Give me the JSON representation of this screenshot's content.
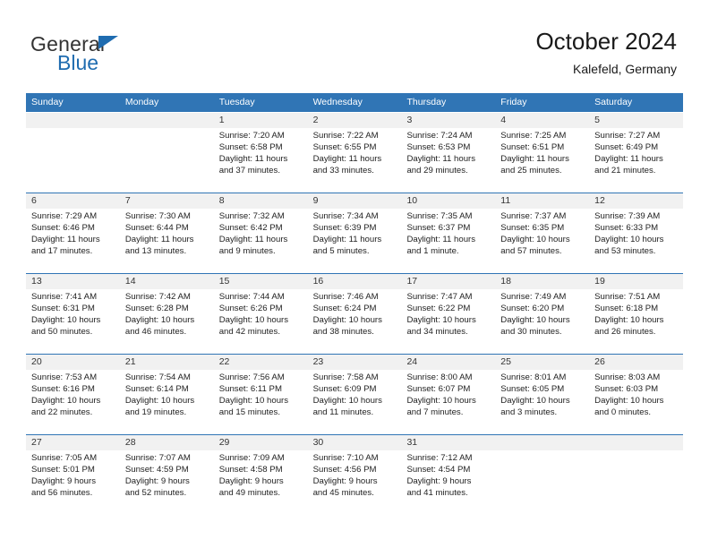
{
  "logo": {
    "text_primary": "General",
    "text_secondary": "Blue",
    "triangle_icon": "triangle-icon",
    "primary_color": "#333333",
    "accent_color": "#1f6cb0"
  },
  "header": {
    "title": "October 2024",
    "subtitle": "Kalefeld, Germany"
  },
  "theme": {
    "header_blue": "#3075b5",
    "date_band_gray": "#f1f1f1",
    "text_color": "#222222"
  },
  "weekdays": [
    "Sunday",
    "Monday",
    "Tuesday",
    "Wednesday",
    "Thursday",
    "Friday",
    "Saturday"
  ],
  "weeks": [
    {
      "days": [
        {
          "num": "",
          "sunrise": "",
          "sunset": "",
          "daylight1": "",
          "daylight2": ""
        },
        {
          "num": "",
          "sunrise": "",
          "sunset": "",
          "daylight1": "",
          "daylight2": ""
        },
        {
          "num": "1",
          "sunrise": "Sunrise: 7:20 AM",
          "sunset": "Sunset: 6:58 PM",
          "daylight1": "Daylight: 11 hours",
          "daylight2": "and 37 minutes."
        },
        {
          "num": "2",
          "sunrise": "Sunrise: 7:22 AM",
          "sunset": "Sunset: 6:55 PM",
          "daylight1": "Daylight: 11 hours",
          "daylight2": "and 33 minutes."
        },
        {
          "num": "3",
          "sunrise": "Sunrise: 7:24 AM",
          "sunset": "Sunset: 6:53 PM",
          "daylight1": "Daylight: 11 hours",
          "daylight2": "and 29 minutes."
        },
        {
          "num": "4",
          "sunrise": "Sunrise: 7:25 AM",
          "sunset": "Sunset: 6:51 PM",
          "daylight1": "Daylight: 11 hours",
          "daylight2": "and 25 minutes."
        },
        {
          "num": "5",
          "sunrise": "Sunrise: 7:27 AM",
          "sunset": "Sunset: 6:49 PM",
          "daylight1": "Daylight: 11 hours",
          "daylight2": "and 21 minutes."
        }
      ]
    },
    {
      "days": [
        {
          "num": "6",
          "sunrise": "Sunrise: 7:29 AM",
          "sunset": "Sunset: 6:46 PM",
          "daylight1": "Daylight: 11 hours",
          "daylight2": "and 17 minutes."
        },
        {
          "num": "7",
          "sunrise": "Sunrise: 7:30 AM",
          "sunset": "Sunset: 6:44 PM",
          "daylight1": "Daylight: 11 hours",
          "daylight2": "and 13 minutes."
        },
        {
          "num": "8",
          "sunrise": "Sunrise: 7:32 AM",
          "sunset": "Sunset: 6:42 PM",
          "daylight1": "Daylight: 11 hours",
          "daylight2": "and 9 minutes."
        },
        {
          "num": "9",
          "sunrise": "Sunrise: 7:34 AM",
          "sunset": "Sunset: 6:39 PM",
          "daylight1": "Daylight: 11 hours",
          "daylight2": "and 5 minutes."
        },
        {
          "num": "10",
          "sunrise": "Sunrise: 7:35 AM",
          "sunset": "Sunset: 6:37 PM",
          "daylight1": "Daylight: 11 hours",
          "daylight2": "and 1 minute."
        },
        {
          "num": "11",
          "sunrise": "Sunrise: 7:37 AM",
          "sunset": "Sunset: 6:35 PM",
          "daylight1": "Daylight: 10 hours",
          "daylight2": "and 57 minutes."
        },
        {
          "num": "12",
          "sunrise": "Sunrise: 7:39 AM",
          "sunset": "Sunset: 6:33 PM",
          "daylight1": "Daylight: 10 hours",
          "daylight2": "and 53 minutes."
        }
      ]
    },
    {
      "days": [
        {
          "num": "13",
          "sunrise": "Sunrise: 7:41 AM",
          "sunset": "Sunset: 6:31 PM",
          "daylight1": "Daylight: 10 hours",
          "daylight2": "and 50 minutes."
        },
        {
          "num": "14",
          "sunrise": "Sunrise: 7:42 AM",
          "sunset": "Sunset: 6:28 PM",
          "daylight1": "Daylight: 10 hours",
          "daylight2": "and 46 minutes."
        },
        {
          "num": "15",
          "sunrise": "Sunrise: 7:44 AM",
          "sunset": "Sunset: 6:26 PM",
          "daylight1": "Daylight: 10 hours",
          "daylight2": "and 42 minutes."
        },
        {
          "num": "16",
          "sunrise": "Sunrise: 7:46 AM",
          "sunset": "Sunset: 6:24 PM",
          "daylight1": "Daylight: 10 hours",
          "daylight2": "and 38 minutes."
        },
        {
          "num": "17",
          "sunrise": "Sunrise: 7:47 AM",
          "sunset": "Sunset: 6:22 PM",
          "daylight1": "Daylight: 10 hours",
          "daylight2": "and 34 minutes."
        },
        {
          "num": "18",
          "sunrise": "Sunrise: 7:49 AM",
          "sunset": "Sunset: 6:20 PM",
          "daylight1": "Daylight: 10 hours",
          "daylight2": "and 30 minutes."
        },
        {
          "num": "19",
          "sunrise": "Sunrise: 7:51 AM",
          "sunset": "Sunset: 6:18 PM",
          "daylight1": "Daylight: 10 hours",
          "daylight2": "and 26 minutes."
        }
      ]
    },
    {
      "days": [
        {
          "num": "20",
          "sunrise": "Sunrise: 7:53 AM",
          "sunset": "Sunset: 6:16 PM",
          "daylight1": "Daylight: 10 hours",
          "daylight2": "and 22 minutes."
        },
        {
          "num": "21",
          "sunrise": "Sunrise: 7:54 AM",
          "sunset": "Sunset: 6:14 PM",
          "daylight1": "Daylight: 10 hours",
          "daylight2": "and 19 minutes."
        },
        {
          "num": "22",
          "sunrise": "Sunrise: 7:56 AM",
          "sunset": "Sunset: 6:11 PM",
          "daylight1": "Daylight: 10 hours",
          "daylight2": "and 15 minutes."
        },
        {
          "num": "23",
          "sunrise": "Sunrise: 7:58 AM",
          "sunset": "Sunset: 6:09 PM",
          "daylight1": "Daylight: 10 hours",
          "daylight2": "and 11 minutes."
        },
        {
          "num": "24",
          "sunrise": "Sunrise: 8:00 AM",
          "sunset": "Sunset: 6:07 PM",
          "daylight1": "Daylight: 10 hours",
          "daylight2": "and 7 minutes."
        },
        {
          "num": "25",
          "sunrise": "Sunrise: 8:01 AM",
          "sunset": "Sunset: 6:05 PM",
          "daylight1": "Daylight: 10 hours",
          "daylight2": "and 3 minutes."
        },
        {
          "num": "26",
          "sunrise": "Sunrise: 8:03 AM",
          "sunset": "Sunset: 6:03 PM",
          "daylight1": "Daylight: 10 hours",
          "daylight2": "and 0 minutes."
        }
      ]
    },
    {
      "days": [
        {
          "num": "27",
          "sunrise": "Sunrise: 7:05 AM",
          "sunset": "Sunset: 5:01 PM",
          "daylight1": "Daylight: 9 hours",
          "daylight2": "and 56 minutes."
        },
        {
          "num": "28",
          "sunrise": "Sunrise: 7:07 AM",
          "sunset": "Sunset: 4:59 PM",
          "daylight1": "Daylight: 9 hours",
          "daylight2": "and 52 minutes."
        },
        {
          "num": "29",
          "sunrise": "Sunrise: 7:09 AM",
          "sunset": "Sunset: 4:58 PM",
          "daylight1": "Daylight: 9 hours",
          "daylight2": "and 49 minutes."
        },
        {
          "num": "30",
          "sunrise": "Sunrise: 7:10 AM",
          "sunset": "Sunset: 4:56 PM",
          "daylight1": "Daylight: 9 hours",
          "daylight2": "and 45 minutes."
        },
        {
          "num": "31",
          "sunrise": "Sunrise: 7:12 AM",
          "sunset": "Sunset: 4:54 PM",
          "daylight1": "Daylight: 9 hours",
          "daylight2": "and 41 minutes."
        },
        {
          "num": "",
          "sunrise": "",
          "sunset": "",
          "daylight1": "",
          "daylight2": ""
        },
        {
          "num": "",
          "sunrise": "",
          "sunset": "",
          "daylight1": "",
          "daylight2": ""
        }
      ]
    }
  ]
}
